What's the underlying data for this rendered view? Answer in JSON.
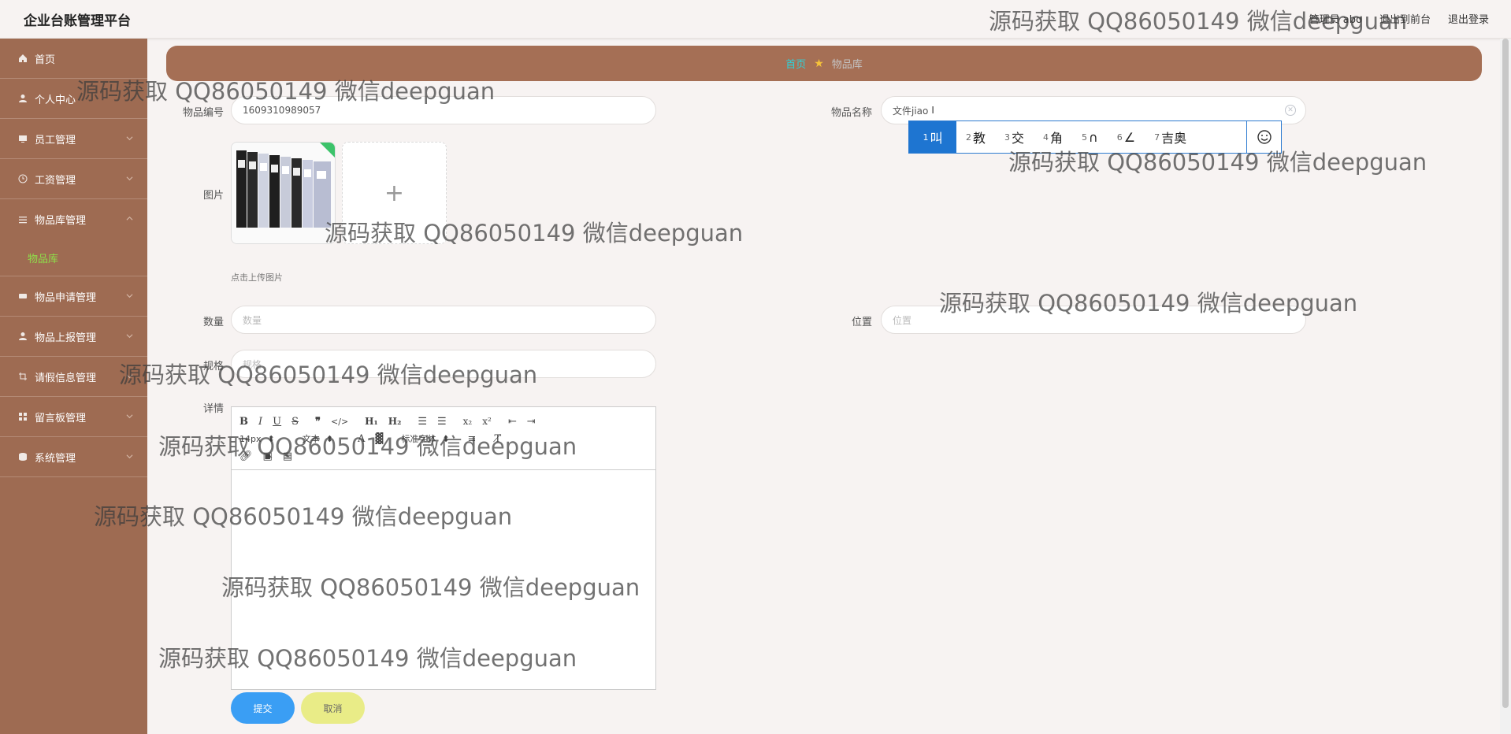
{
  "header": {
    "title": "企业台账管理平台",
    "links": [
      "管理员 abo",
      "退出到前台",
      "退出登录"
    ]
  },
  "sidebar": {
    "items": [
      {
        "label": "首页",
        "icon": "home-icon",
        "chevron": false
      },
      {
        "label": "个人中心",
        "icon": "user-icon",
        "chevron": false
      },
      {
        "label": "员工管理",
        "icon": "monitor-icon",
        "chevron": true
      },
      {
        "label": "工资管理",
        "icon": "clock-icon",
        "chevron": true
      },
      {
        "label": "物品库管理",
        "icon": "list-icon",
        "chevron": true,
        "expanded": true,
        "children": [
          "物品库"
        ]
      },
      {
        "label": "物品申请管理",
        "icon": "card-icon",
        "chevron": true
      },
      {
        "label": "物品上报管理",
        "icon": "user-icon",
        "chevron": true
      },
      {
        "label": "请假信息管理",
        "icon": "crop-icon",
        "chevron": true
      },
      {
        "label": "留言板管理",
        "icon": "grid-icon",
        "chevron": true
      },
      {
        "label": "系统管理",
        "icon": "database-icon",
        "chevron": true
      }
    ],
    "active_sub": "物品库"
  },
  "breadcrumb": {
    "home": "首页",
    "current": "物品库"
  },
  "form": {
    "code_label": "物品编号",
    "code_value": "1609310989057",
    "name_label": "物品名称",
    "name_value": "文件jiao",
    "image_label": "图片",
    "upload_tip": "点击上传图片",
    "qty_label": "数量",
    "qty_placeholder": "数量",
    "loc_label": "位置",
    "loc_placeholder": "位置",
    "spec_label": "规格",
    "spec_placeholder": "规格",
    "detail_label": "详情"
  },
  "ime": {
    "candidates": [
      {
        "n": "1",
        "text": "叫"
      },
      {
        "n": "2",
        "text": "教"
      },
      {
        "n": "3",
        "text": "交"
      },
      {
        "n": "4",
        "text": "角"
      },
      {
        "n": "5",
        "text": "∩"
      },
      {
        "n": "6",
        "text": "∠"
      },
      {
        "n": "7",
        "text": "吉奥"
      }
    ]
  },
  "editor": {
    "font_size": "14px",
    "text_type": "文本",
    "font_family": "标准字体"
  },
  "buttons": {
    "submit": "提交",
    "cancel": "取消"
  },
  "watermark": "源码获取 QQ86050149 微信deepguan",
  "colors": {
    "sidebar": "#9e6b52",
    "breadcrumb": "#a56f55",
    "active_sub": "#8ee04a",
    "submit": "#3a9ef4",
    "cancel": "#e9ec87"
  }
}
